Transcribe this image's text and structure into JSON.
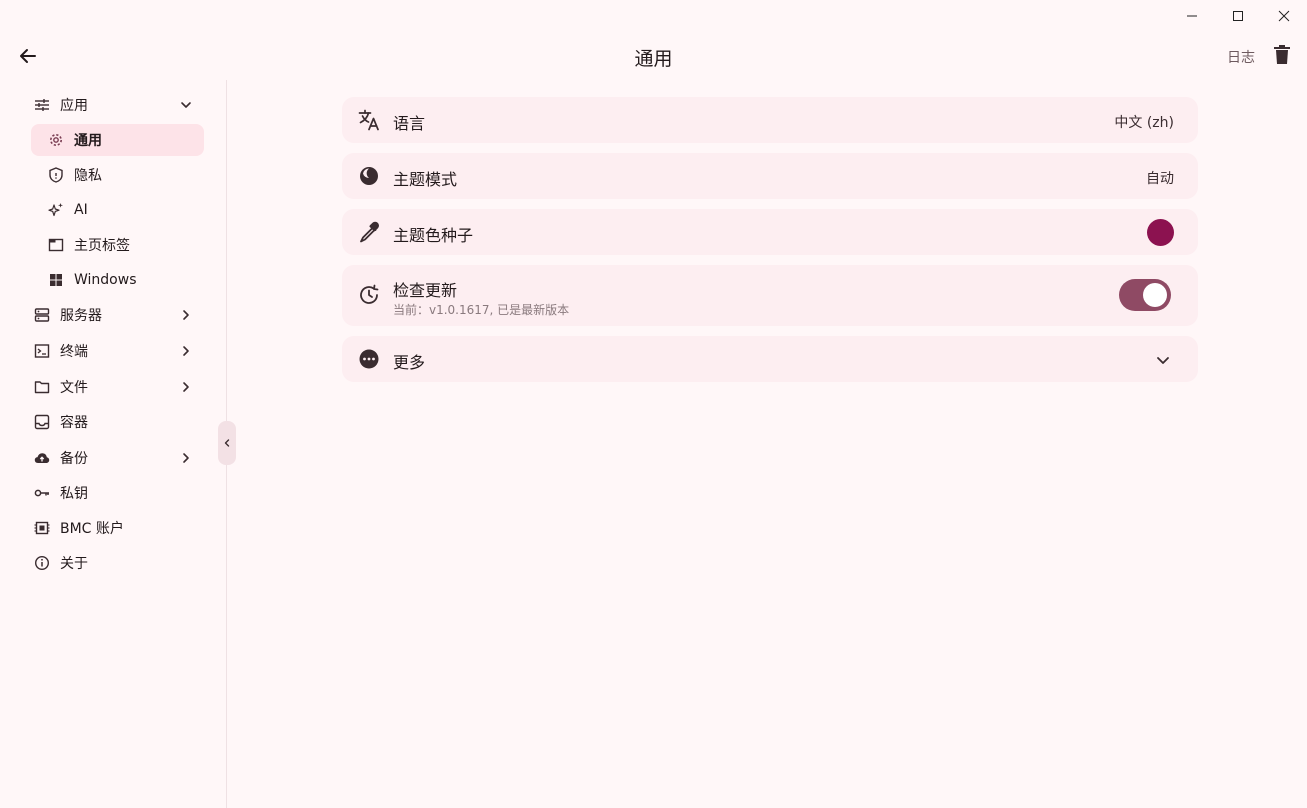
{
  "header": {
    "title": "通用",
    "log_label": "日志"
  },
  "sidebar": {
    "items": [
      {
        "label": "应用"
      },
      {
        "label": "通用"
      },
      {
        "label": "隐私"
      },
      {
        "label": "AI"
      },
      {
        "label": "主页标签"
      },
      {
        "label": "Windows"
      },
      {
        "label": "服务器"
      },
      {
        "label": "终端"
      },
      {
        "label": "文件"
      },
      {
        "label": "容器"
      },
      {
        "label": "备份"
      },
      {
        "label": "私钥"
      },
      {
        "label": "BMC 账户"
      },
      {
        "label": "关于"
      }
    ]
  },
  "settings": {
    "language": {
      "label": "语言",
      "value": "中文 (zh)"
    },
    "theme_mode": {
      "label": "主题模式",
      "value": "自动"
    },
    "theme_seed": {
      "label": "主题色种子"
    },
    "check_update": {
      "label": "检查更新",
      "sub": "当前：v1.0.1617, 已是最新版本",
      "enabled": true
    },
    "more": {
      "label": "更多"
    }
  },
  "colors": {
    "seed": "#8c1250",
    "toggle_track": "#8f4a64",
    "accent_bg": "#fde3e8"
  }
}
